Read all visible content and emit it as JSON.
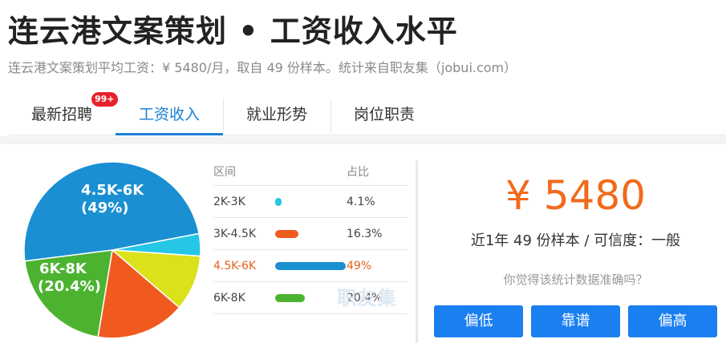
{
  "header": {
    "title": "连云港文案策划 • 工资收入水平",
    "subtitle": "连云港文案策划平均工资：¥ 5480/月，取自 49 份样本。统计来自职友集（jobui.com）"
  },
  "tabs": [
    {
      "label": "最新招聘",
      "badge": "99+",
      "active": false
    },
    {
      "label": "工资收入",
      "active": true
    },
    {
      "label": "就业形势",
      "active": false
    },
    {
      "label": "岗位职责",
      "active": false
    }
  ],
  "table": {
    "header_range": "区间",
    "header_share": "占比",
    "rows": [
      {
        "range": "2K-3K",
        "share": "4.1%"
      },
      {
        "range": "3K-4.5K",
        "share": "16.3%"
      },
      {
        "range": "4.5K-6K",
        "share": "49%"
      },
      {
        "range": "6K-8K",
        "share": "20.4%"
      }
    ]
  },
  "pie_labels": {
    "big_range": "4.5K-6K",
    "big_pct": "(49%)",
    "second_range": "6K-8K",
    "second_pct": "(20.4%)"
  },
  "watermark": "职友集",
  "summary": {
    "salary": "¥ 5480",
    "sample_line": "近1年 49 份样本 / 可信度：一般",
    "question": "你觉得该统计数据准确吗？",
    "buttons": [
      "偏低",
      "靠谱",
      "偏高"
    ]
  },
  "chart_data": {
    "type": "pie",
    "categories": [
      "2K-3K",
      "3K-4.5K",
      "4.5K-6K",
      "6K-8K",
      "Other"
    ],
    "values": [
      4.1,
      16.3,
      49,
      20.4,
      10.2
    ],
    "colors": [
      "#25c6e6",
      "#f05a1e",
      "#1a8fd2",
      "#4cb331",
      "#dbe11a"
    ]
  },
  "colors": {
    "accent_blue": "#1a7fd6",
    "salary_orange": "#f16a1b",
    "badge_red": "#e8222c",
    "button_blue": "#1a7ff0"
  }
}
